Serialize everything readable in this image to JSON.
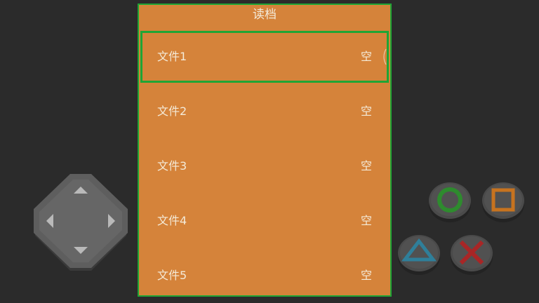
{
  "panel": {
    "title": "读档",
    "selected_index": 0,
    "slots": [
      {
        "name": "文件1",
        "status": "空"
      },
      {
        "name": "文件2",
        "status": "空"
      },
      {
        "name": "文件3",
        "status": "空"
      },
      {
        "name": "文件4",
        "status": "空"
      },
      {
        "name": "文件5",
        "status": "空"
      }
    ]
  },
  "controls": {
    "dpad_icon": "dpad-icon",
    "buttons": [
      {
        "id": "circle",
        "icon": "circle-icon",
        "color": "#2e8b2e"
      },
      {
        "id": "square",
        "icon": "square-icon",
        "color": "#c7731f"
      },
      {
        "id": "triangle",
        "icon": "triangle-icon",
        "color": "#2f7f9a"
      },
      {
        "id": "cross",
        "icon": "cross-icon",
        "color": "#a82626"
      }
    ]
  },
  "colors": {
    "background": "#2b2b2b",
    "panel": "#d5833a",
    "border": "#1fa535",
    "text": "#f4ead8"
  }
}
